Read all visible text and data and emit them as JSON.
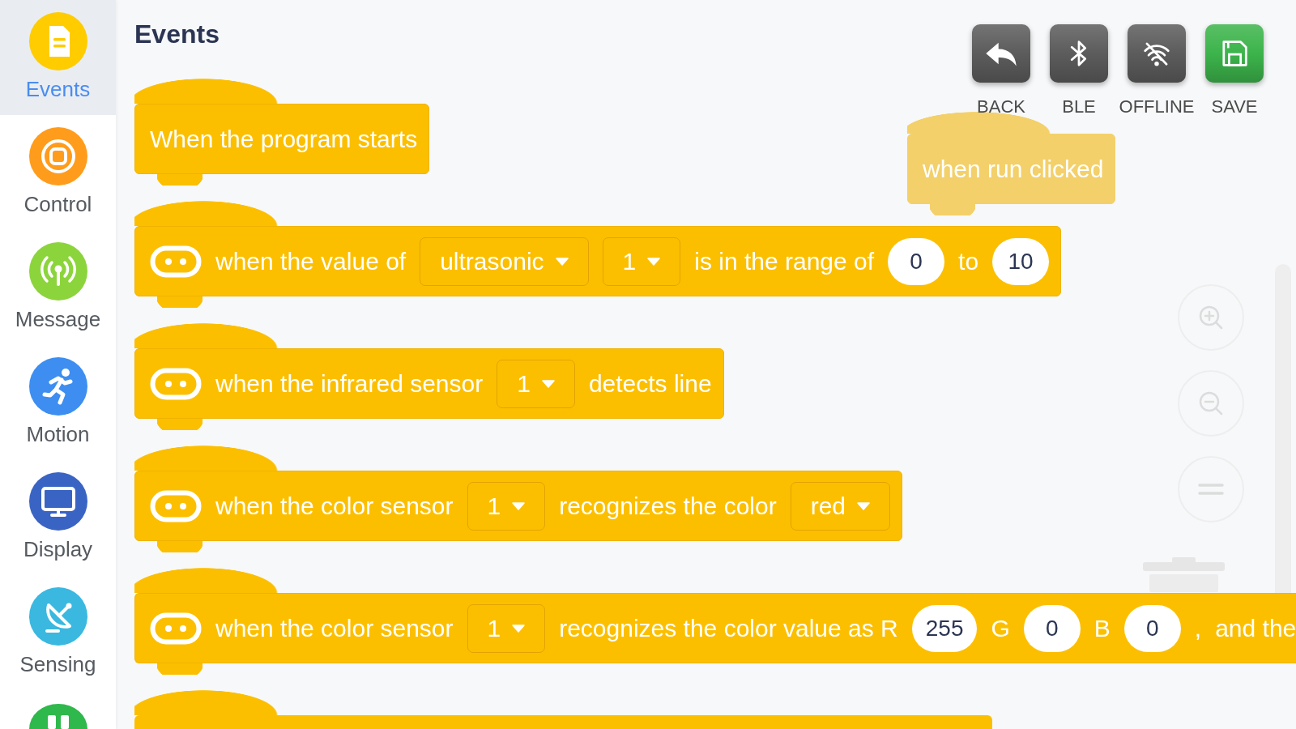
{
  "sidebar": {
    "items": [
      {
        "label": "Events",
        "selected": true,
        "color": "#ffcc00"
      },
      {
        "label": "Control",
        "selected": false,
        "color": "#ff9c1c"
      },
      {
        "label": "Message",
        "selected": false,
        "color": "#8cd43c"
      },
      {
        "label": "Motion",
        "selected": false,
        "color": "#3d8ef0"
      },
      {
        "label": "Display",
        "selected": false,
        "color": "#3a64c4"
      },
      {
        "label": "Sensing",
        "selected": false,
        "color": "#3ab8e0"
      },
      {
        "selected": false,
        "color": "#2fb84c"
      }
    ]
  },
  "workspace": {
    "title": "Events",
    "toolbar": [
      {
        "label": "BACK",
        "color": "#5c5c5c"
      },
      {
        "label": "BLE",
        "color": "#5c5c5c"
      },
      {
        "label": "OFFLINE",
        "color": "#5c5c5c"
      },
      {
        "label": "SAVE",
        "color": "#3cb44b"
      }
    ],
    "blocks": [
      {
        "kind": "hat",
        "parts": [
          {
            "kind": "text",
            "text": "When the program starts"
          }
        ]
      },
      {
        "kind": "hat",
        "parts": [
          {
            "kind": "icon"
          },
          {
            "kind": "text",
            "text": "when the value of"
          },
          {
            "kind": "dropdown",
            "value": "ultrasonic"
          },
          {
            "kind": "dropdown",
            "value": "1"
          },
          {
            "kind": "text",
            "text": "is in the range of"
          },
          {
            "kind": "number",
            "value": "0"
          },
          {
            "kind": "text",
            "text": "to"
          },
          {
            "kind": "number",
            "value": "10"
          }
        ]
      },
      {
        "kind": "hat",
        "parts": [
          {
            "kind": "icon"
          },
          {
            "kind": "text",
            "text": "when the infrared sensor"
          },
          {
            "kind": "dropdown",
            "value": "1"
          },
          {
            "kind": "text",
            "text": "detects line"
          }
        ]
      },
      {
        "kind": "hat",
        "parts": [
          {
            "kind": "icon"
          },
          {
            "kind": "text",
            "text": "when the color sensor"
          },
          {
            "kind": "dropdown",
            "value": "1"
          },
          {
            "kind": "text",
            "text": "recognizes the color"
          },
          {
            "kind": "dropdown",
            "value": "red"
          }
        ]
      },
      {
        "kind": "hat",
        "truncated": true,
        "parts": [
          {
            "kind": "icon"
          },
          {
            "kind": "text",
            "text": "when the color sensor"
          },
          {
            "kind": "dropdown",
            "value": "1"
          },
          {
            "kind": "text",
            "text": "recognizes the color value as R"
          },
          {
            "kind": "number",
            "value": "255"
          },
          {
            "kind": "text",
            "text": "G"
          },
          {
            "kind": "number",
            "value": "0"
          },
          {
            "kind": "text",
            "text": "B"
          },
          {
            "kind": "number",
            "value": "0"
          },
          {
            "kind": "text",
            "text": ","
          },
          {
            "kind": "text",
            "text": "and the"
          }
        ]
      },
      {
        "kind": "hat"
      }
    ],
    "dragged_block": {
      "text": "when run clicked"
    }
  }
}
